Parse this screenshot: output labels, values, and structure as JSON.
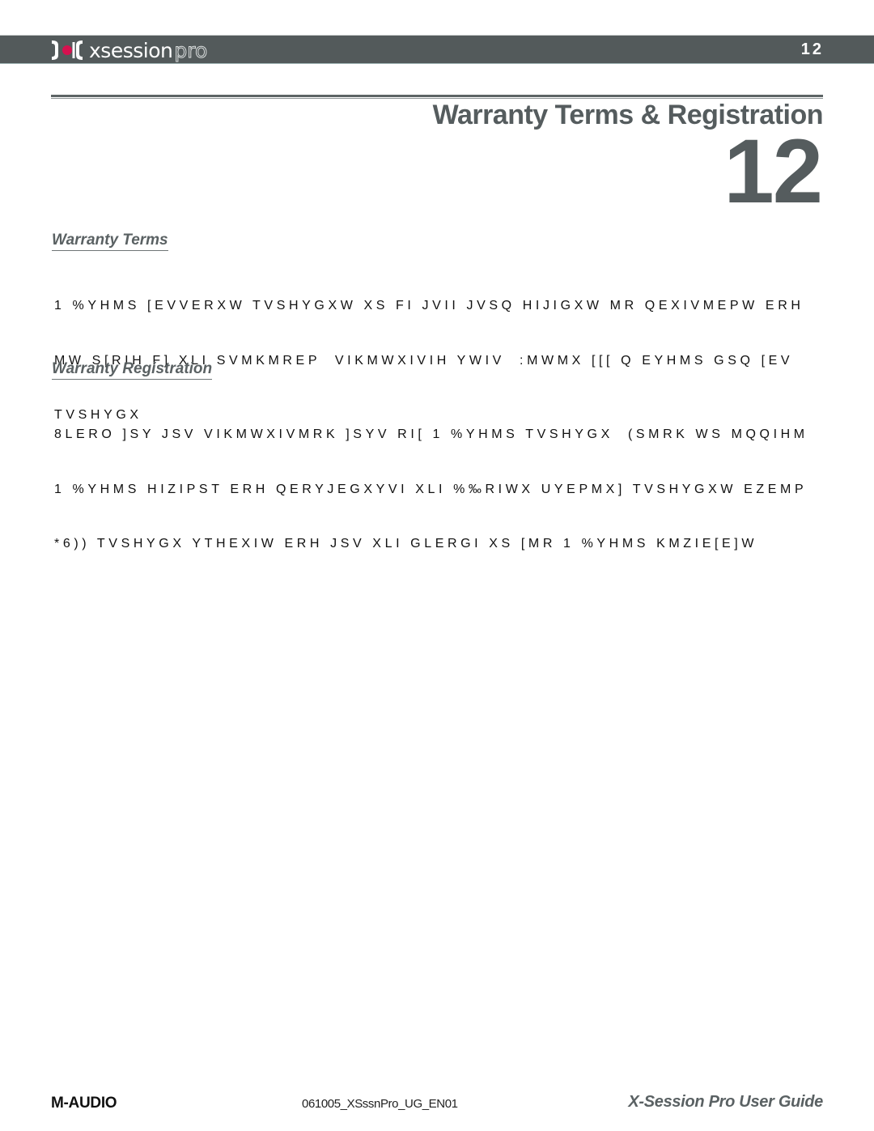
{
  "header": {
    "logo_text": "xsession",
    "logo_suffix": "pro",
    "page_number": "12",
    "accent_color": "#d6114f",
    "bar_color": "#535a5b"
  },
  "chapter": {
    "title": "Warranty Terms & Registration",
    "number": "12"
  },
  "sections": [
    {
      "heading": "Warranty Terms",
      "lines": [
        "1 %YHMS [EVVERXW TVSHYGXW XS FI JVII JVSQ HIJIGXW MR QEXIVMEPW ERH",
        "MW S[RIH F] XLI SVMKMREP  VIKMWXIVIH YWIV  :MWMX [[[ Q EYHMS GSQ [EV",
        "TVSHYGX"
      ]
    },
    {
      "heading": "Warranty Registration",
      "lines": [
        "8LERO ]SY JSV VIKMWXIVMRK ]SYV RI[ 1 %YHMS TVSHYGX  (SMRK WS MQQIHM",
        "1 %YHMS HIZIPST ERH QERYJEGXYVI XLI %‰RIWX UYEPMX] TVSHYGXW EZEMP",
        "*6)) TVSHYGX YTHEXIW ERH JSV XLI GLERGI XS [MR 1 %YHMS KMZIE[E]W"
      ]
    }
  ],
  "footer": {
    "brand": "M-AUDIO",
    "doc_id": "061005_XSssnPro_UG_EN01",
    "guide_title": "X-Session Pro User Guide"
  }
}
